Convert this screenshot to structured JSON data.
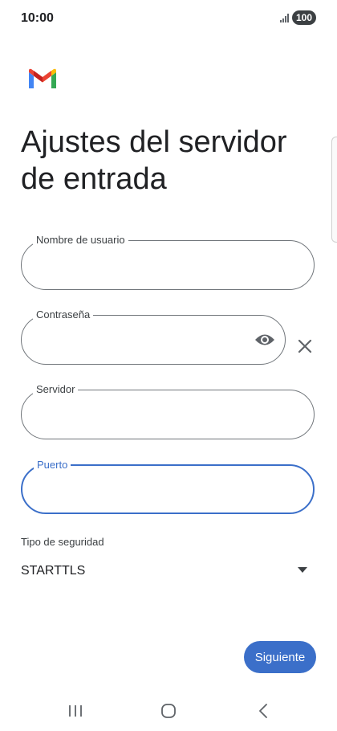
{
  "status_bar": {
    "time": "10:00",
    "battery": "100",
    "icons": [
      "signal-icon",
      "battery-icon"
    ]
  },
  "app": {
    "logo": "gmail-logo"
  },
  "page": {
    "title": "Ajustes del servidor de entrada"
  },
  "form": {
    "username": {
      "label": "Nombre de usuario",
      "value": ""
    },
    "password": {
      "label": "Contraseña",
      "value": "",
      "icons": [
        "eye-icon",
        "close-icon"
      ]
    },
    "server": {
      "label": "Servidor",
      "value": ""
    },
    "port": {
      "label": "Puerto",
      "value": "",
      "focused": true
    },
    "security": {
      "label": "Tipo de seguridad",
      "value": "STARTTLS",
      "icon": "dropdown-arrow-icon"
    }
  },
  "actions": {
    "next_label": "Siguiente"
  },
  "navigation": {
    "icons": [
      "recents-icon",
      "home-icon",
      "back-icon"
    ]
  },
  "colors": {
    "accent": "#3b6fc9",
    "field_border": "#70757a",
    "text": "#202124"
  }
}
